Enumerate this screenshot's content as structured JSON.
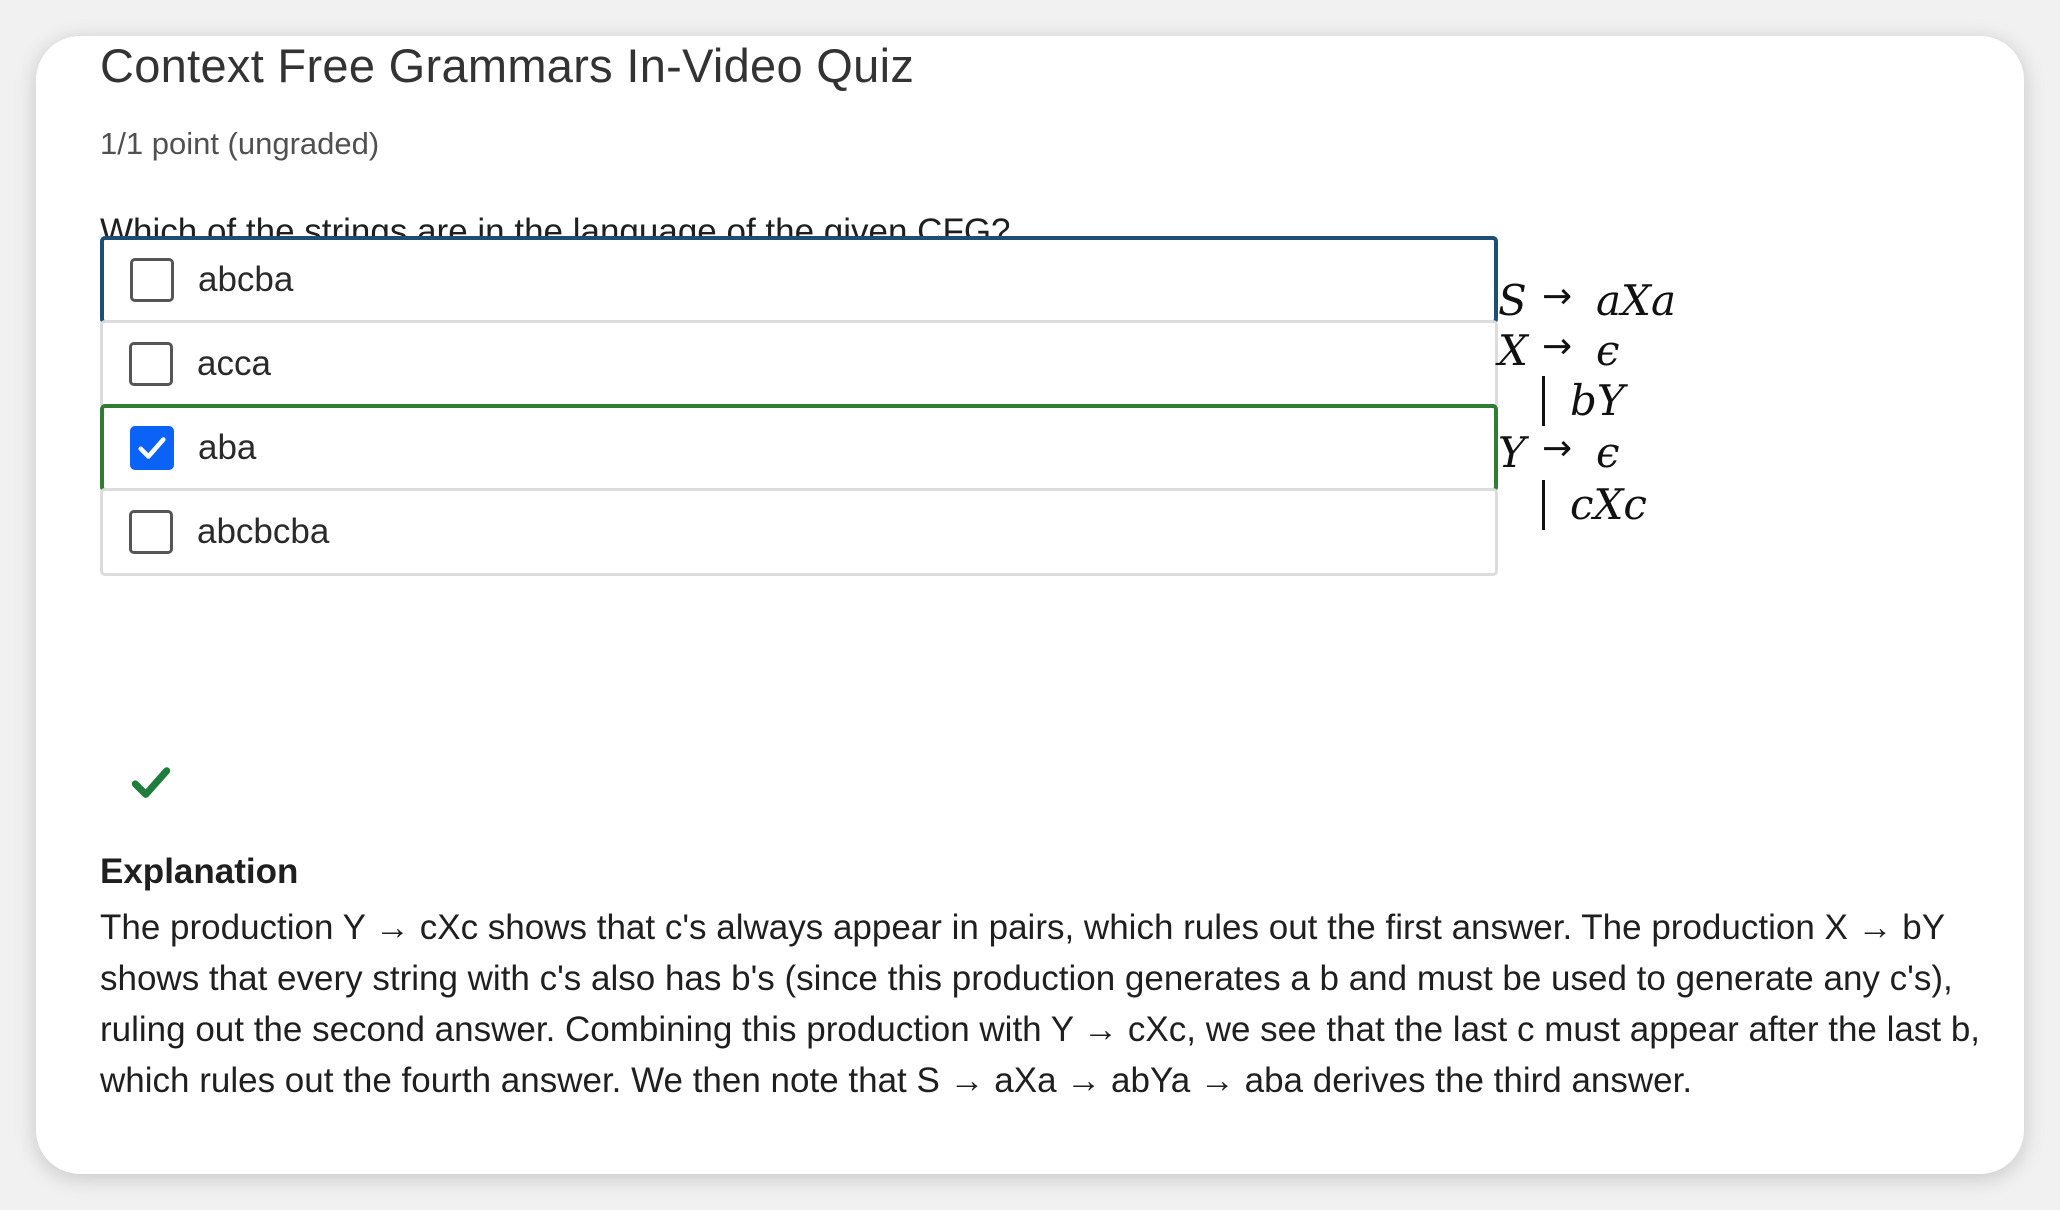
{
  "quiz": {
    "title": "Context Free Grammars In-Video Quiz",
    "points": "1/1 point (ungraded)",
    "question": "Which of the strings are in the language of the given CFG?",
    "options": [
      {
        "label": "abcba",
        "checked": false
      },
      {
        "label": "acca",
        "checked": false
      },
      {
        "label": "aba",
        "checked": true
      },
      {
        "label": "abcbcba",
        "checked": false
      }
    ],
    "result_icon": "checkmark-icon",
    "colors": {
      "focus_border": "#1d4f73",
      "correct_border": "#2f7d32",
      "checkbox_checked": "#0b62f6",
      "check_icon": "#1e7d3c"
    }
  },
  "grammar": {
    "arrow": "→",
    "rules": [
      {
        "lhs": "S",
        "rhs": "aXa"
      },
      {
        "lhs": "X",
        "rhs": "ϵ"
      },
      {
        "alt": "bY"
      },
      {
        "lhs": "Y",
        "rhs": "ϵ"
      },
      {
        "alt": "cXc"
      }
    ]
  },
  "explanation": {
    "heading": "Explanation",
    "text": "The production Y → cXc shows that c's always appear in pairs, which rules out the first answer. The production X → bY shows that every string with c's also has b's (since this production generates a b and must be used to generate any c's), ruling out the second answer. Combining this production with Y → cXc, we see that the last c must appear after the last b, which rules out the fourth answer. We then note that S → aXa → abYa → aba derives the third answer."
  }
}
